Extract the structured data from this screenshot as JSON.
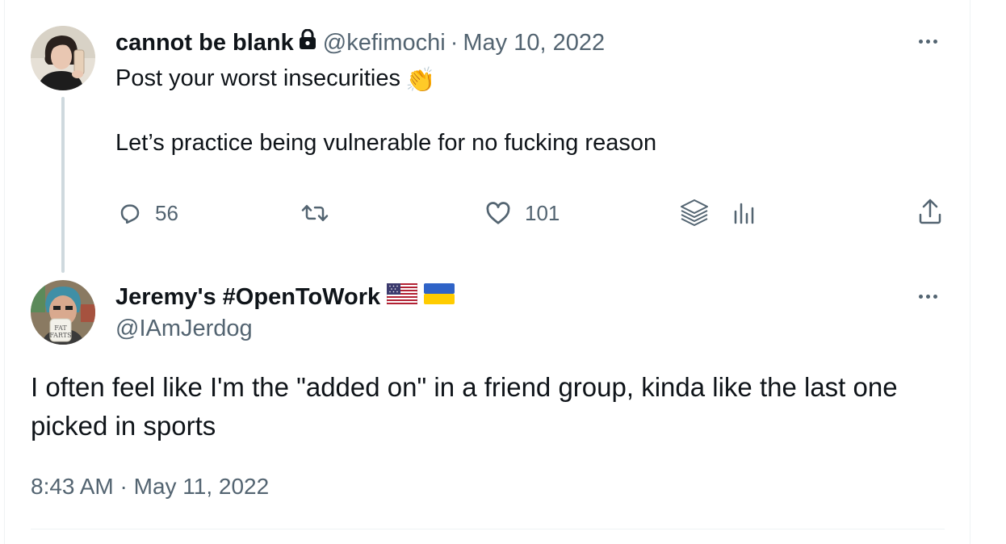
{
  "parent_tweet": {
    "display_name": "cannot be blank",
    "protected_icon": "lock-icon",
    "handle": "@kefimochi",
    "separator": "·",
    "date": "May 10, 2022",
    "text_line_1": "Post your worst insecurities",
    "emoji": "👏",
    "text_line_2": "Let’s practice being vulnerable for no fucking reason",
    "actions": {
      "reply_count": "56",
      "like_count": "101"
    }
  },
  "reply_tweet": {
    "display_name": "Jeremy's #OpenToWork",
    "flags": [
      "us-flag-icon",
      "ukraine-flag-icon"
    ],
    "handle": "@IAmJerdog",
    "text": "I often feel like I'm the \"added on\" in a friend group, kinda like the last one picked in sports",
    "timestamp": "8:43 AM · May 11, 2022",
    "avatar_mug_text": "FAT FARTS"
  },
  "colors": {
    "text_primary": "#0f1419",
    "text_secondary": "#536471",
    "thread_line": "#cfd9de",
    "divider": "#eff3f4"
  }
}
